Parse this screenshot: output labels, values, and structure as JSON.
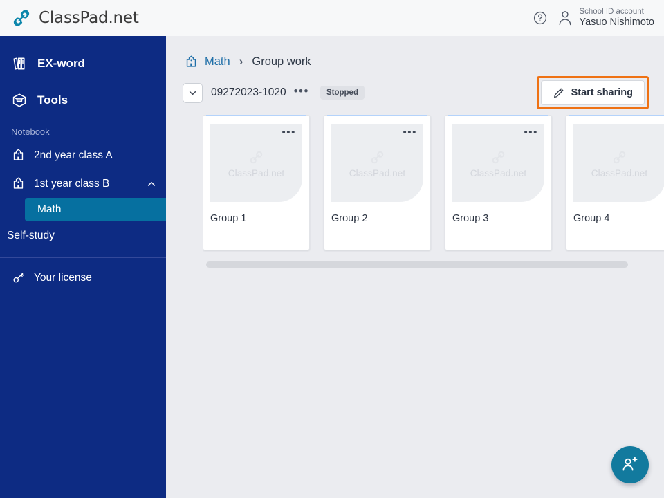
{
  "header": {
    "brand": "ClassPad.net",
    "logo_icon": "link-chain-icon",
    "help_icon": "question-mark-circle-icon",
    "avatar_icon": "person-icon",
    "account_role": "School ID account",
    "account_name": "Yasuo Nishimoto"
  },
  "sidebar": {
    "top_items": [
      {
        "label": "EX-word",
        "icon": "books-icon"
      },
      {
        "label": "Tools",
        "icon": "toolbox-cube-icon"
      }
    ],
    "section_label": "Notebook",
    "classes": [
      {
        "label": "2nd year class A",
        "icon": "school-building-icon",
        "expanded": false
      },
      {
        "label": "1st year class B",
        "icon": "school-building-icon",
        "expanded": true,
        "chevron_icon": "chevron-up-icon"
      }
    ],
    "subitems": [
      {
        "label": "Math",
        "active": true
      }
    ],
    "self_study": "Self-study",
    "license": {
      "label": "Your license",
      "icon": "key-icon"
    }
  },
  "breadcrumb": {
    "icon": "school-building-icon",
    "link": "Math",
    "separator": "›",
    "current": "Group work"
  },
  "session": {
    "expand_icon": "chevron-down-icon",
    "name": "09272023-1020",
    "menu_icon": "ellipsis-icon",
    "menu_label": "•••",
    "status": "Stopped",
    "share_button": {
      "label": "Start sharing",
      "icon": "pencil-icon",
      "highlight_color": "#ef7214"
    }
  },
  "cards": [
    {
      "name": "Group 1",
      "watermark": "ClassPad.net",
      "menu_label": "•••",
      "clipped": false
    },
    {
      "name": "Group 2",
      "watermark": "ClassPad.net",
      "menu_label": "•••",
      "clipped": false
    },
    {
      "name": "Group 3",
      "watermark": "ClassPad.net",
      "menu_label": "•••",
      "clipped": false
    },
    {
      "name": "Group 4",
      "watermark": "ClassPad.net",
      "menu_label": "",
      "clipped": true
    }
  ],
  "fab": {
    "icon": "add-person-icon"
  },
  "colors": {
    "sidebar_navy": "#0d2b83",
    "accent_teal": "#0670a0",
    "fab_teal": "#127a9e",
    "highlight_orange": "#ef7214",
    "card_top_blue": "#b4d3fb",
    "content_bg": "#ebecf0",
    "header_bg": "#f7f8f9"
  }
}
